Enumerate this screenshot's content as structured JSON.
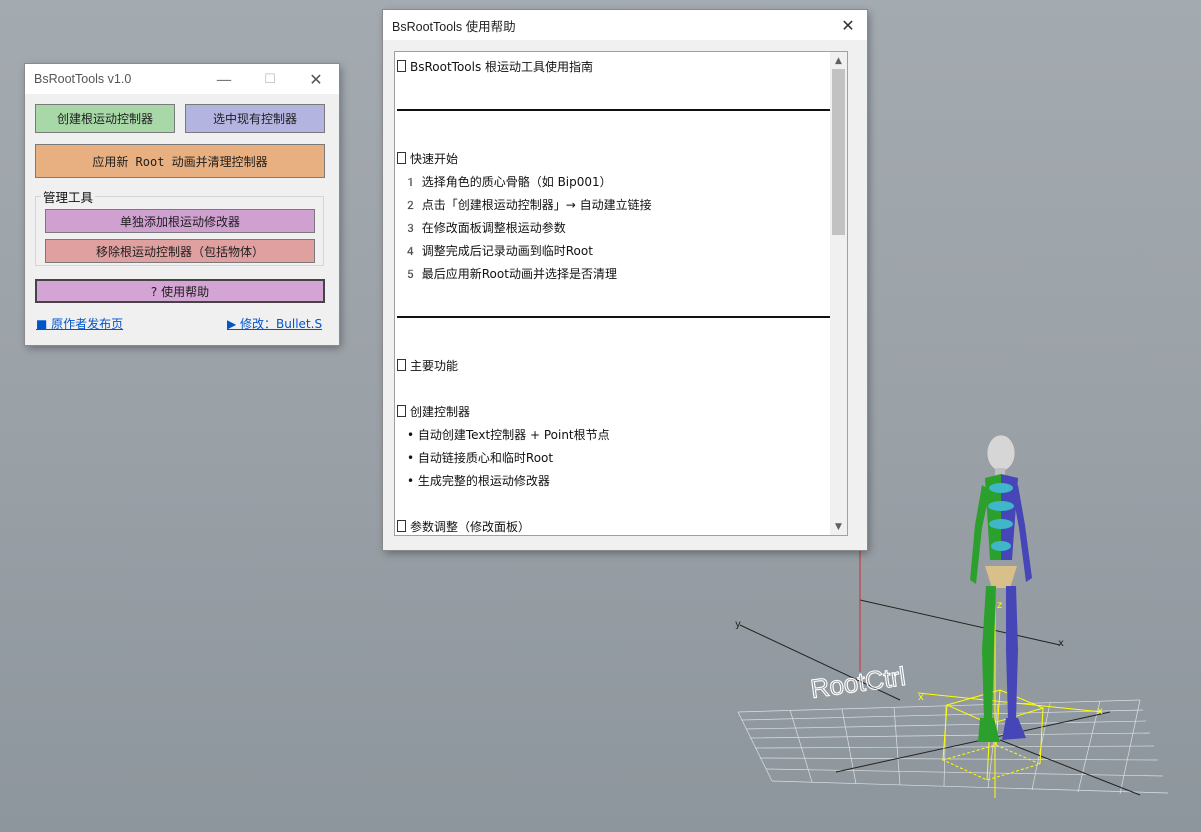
{
  "tools_window": {
    "title": "BsRootTools v1.0",
    "minimize_glyph": "—",
    "maximize_glyph": "☐",
    "close_glyph": "✕",
    "create_btn": "创建根运动控制器",
    "select_btn": "选中现有控制器",
    "apply_btn": "应用新 Root 动画并清理控制器",
    "group_label": "管理工具",
    "add_modifier_btn": "单独添加根运动修改器",
    "remove_btn": "移除根运动控制器（包括物体）",
    "help_btn": "? 使用帮助",
    "link_left": "■ 原作者发布页",
    "link_right": "▶ 修改：Bullet.S",
    "colors": {
      "create": "#a8d8a8",
      "select": "#b4b4e0",
      "apply": "#e8b080",
      "add_modifier": "#d0a0d0",
      "remove": "#e0a0a0",
      "help": "#d4a4d4"
    }
  },
  "help_window": {
    "title": "BsRootTools 使用帮助",
    "close_glyph": "✕",
    "heading": "BsRootTools 根运动工具使用指南",
    "quick_start": "快速开始",
    "steps": [
      "1️ 选择角色的质心骨骼（如 Bip001）",
      "2️ 点击「创建根运动控制器」→ 自动建立链接",
      "3️ 在修改面板调整根运动参数",
      "4️ 调整完成后记录动画到临时Root",
      "5️ 最后应用新Root动画并选择是否清理"
    ],
    "main_features": "主要功能",
    "create_controller": "创建控制器",
    "bullets": [
      "• 自动创建Text控制器 + Point根节点",
      "• 自动链接质心和临时Root",
      "• 生成完整的根运动修改器"
    ],
    "param_adjust": "参数调整（修改面板）"
  },
  "viewport": {
    "root_label": "RootCtrl",
    "axis_y": "y",
    "axis_x": "x",
    "axis_z": "z",
    "grid_color": "#e8e8e8",
    "gizmo_color": "#ffff00"
  }
}
